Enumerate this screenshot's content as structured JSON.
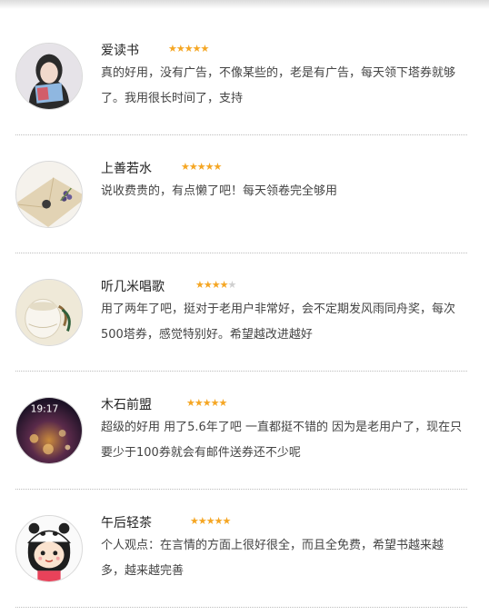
{
  "reviews": [
    {
      "name": "爱读书",
      "rating": 5,
      "text": "真的好用，没有广告，不像某些的，老是有广告，每天领下塔券就够了。我用很长时间了，支持"
    },
    {
      "name": "上善若水",
      "rating": 5,
      "text": "说收费贵的，有点懒了吧！每天领卷完全够用"
    },
    {
      "name": "听几米唱歌",
      "rating": 4,
      "text": "用了两年了吧，挺对于老用户非常好，会不定期发风雨同舟奖，每次500塔券，感觉特别好。希望越改进越好"
    },
    {
      "name": "木石前盟",
      "rating": 5,
      "text": "超级的好用  用了5.6年了吧  一直都挺不错的  因为是老用户了，现在只要少于100券就会有邮件送券还不少呢"
    },
    {
      "name": "午后轻茶",
      "rating": 5,
      "text": "个人观点：在言情的方面上很好很全，而且全免费，希望书越来越多，越来越完善"
    }
  ],
  "avatar_texts": {
    "clock": "19:17"
  },
  "colors": {
    "star_on": "#f5a623",
    "star_off": "#cfcfcf"
  }
}
